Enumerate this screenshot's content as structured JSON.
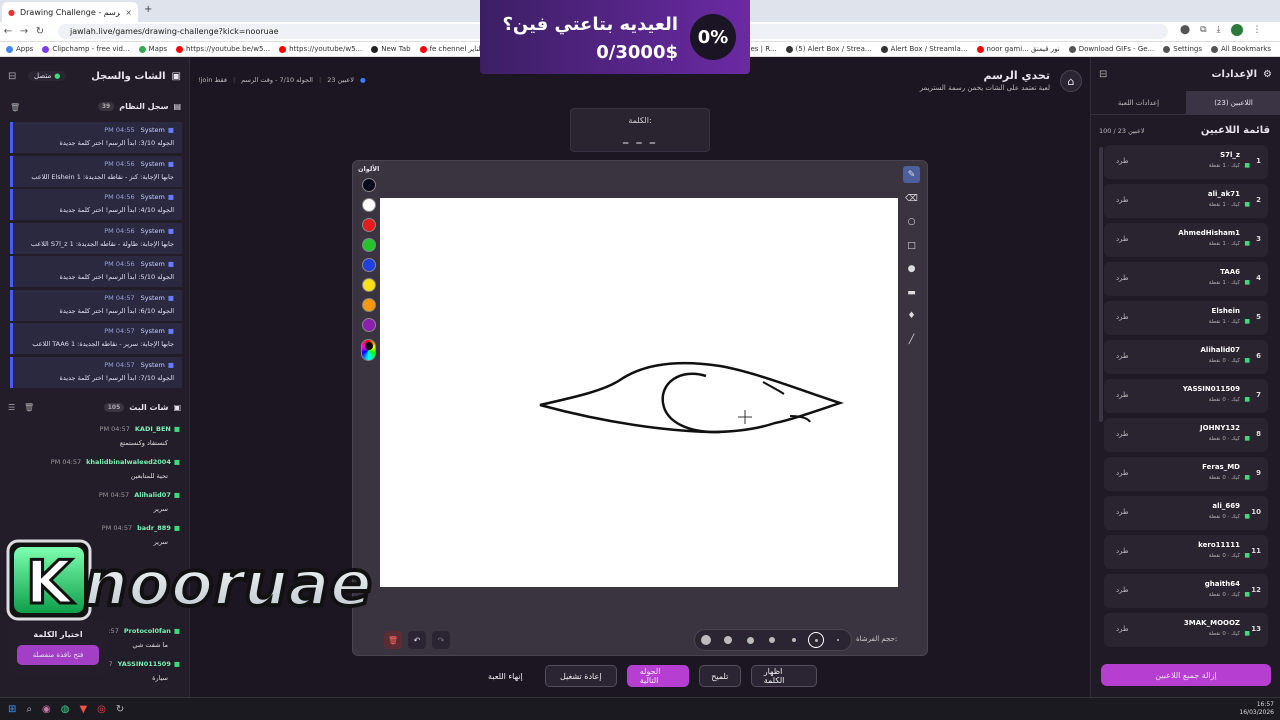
{
  "browser": {
    "tab_title": "Drawing Challenge - تحدي الرسم",
    "tab_close": "×",
    "new_tab": "+",
    "url": "jawlah.live/games/drawing-challenge?kick=nooruae"
  },
  "bookmarks": [
    {
      "label": "Apps",
      "color": "#4285f4"
    },
    {
      "label": "Clipchamp - free vid...",
      "color": "#7a3cf5"
    },
    {
      "label": "Maps",
      "color": "#34a853"
    },
    {
      "label": "https://youtube.be/w5...",
      "color": "#ff0000"
    },
    {
      "label": "https://youtube/w5...",
      "color": "#ff0000"
    },
    {
      "label": "New Tab",
      "color": "#222"
    },
    {
      "label": "fe chennel الناير PU...",
      "color": "#ff0000"
    }
  ],
  "bookmarks_right": [
    {
      "label": "Wheel of Names | R...",
      "color": "#c44"
    },
    {
      "label": "(5) Alert Box / Strea...",
      "color": "#333"
    },
    {
      "label": "Alert Box / Streamla...",
      "color": "#333"
    },
    {
      "label": "noor gami... نور قيمنق",
      "color": "#ff0000"
    },
    {
      "label": "Download GIFs - Ge...",
      "color": "#555"
    },
    {
      "label": "Settings",
      "color": "#555"
    },
    {
      "label": "All Bookmarks",
      "color": "#555"
    }
  ],
  "banner": {
    "title": "العيديه بتاعتي فين؟",
    "value": "0/3000$",
    "percent": "0%"
  },
  "header": {
    "title": "تحدي الرسم",
    "subtitle": "لعبة تعتمد على الشات يخمن رسمة الستريمر",
    "players": "23 لاعبين",
    "round": "الجوله 7/10 - وقت الرسم",
    "join": "!join فقط"
  },
  "left": {
    "title": "الشات والسجل",
    "status": "متصل",
    "system_log": "سجل النظام",
    "log_count": "39",
    "chat_title": "شات البث",
    "chat_count": "105"
  },
  "system_messages": [
    {
      "time": "PM 04:55",
      "sender": "System",
      "text": "الجوله 3/10: ابدأ الرسم! اختر كلمة جديدة"
    },
    {
      "time": "PM 04:56",
      "sender": "System",
      "text": "اللاعب Elshein جابها الإجابة: كنز - نقاطه الجديدة: 1"
    },
    {
      "time": "PM 04:56",
      "sender": "System",
      "text": "الجوله 4/10: ابدأ الرسم! اختر كلمة جديدة"
    },
    {
      "time": "PM 04:56",
      "sender": "System",
      "text": "اللاعب S7l_z جابها الإجابة: طاولة - نقاطه الجديدة: 1"
    },
    {
      "time": "PM 04:56",
      "sender": "System",
      "text": "الجوله 5/10: ابدأ الرسم! اختر كلمة جديدة"
    },
    {
      "time": "PM 04:57",
      "sender": "System",
      "text": "الجوله 6/10: ابدأ الرسم! اختر كلمة جديدة"
    },
    {
      "time": "PM 04:57",
      "sender": "System",
      "text": "اللاعب TAA6 جابها الإجابة: سرير - نقاطه الجديدة: 1"
    },
    {
      "time": "PM 04:57",
      "sender": "System",
      "text": "الجوله 7/10: ابدأ الرسم! اختر كلمة جديدة"
    }
  ],
  "chat_messages": [
    {
      "name": "KADI_BEN",
      "time": "PM 04:57",
      "text": "كنستفاد وكنستمتع"
    },
    {
      "name": "khalidbinalwaleed2004",
      "time": "PM 04:57",
      "text": "تحية للمتابعين"
    },
    {
      "name": "Alihalid07",
      "time": "PM 04:57",
      "text": "سرير"
    },
    {
      "name": "badr_889",
      "time": "PM 04:57",
      "text": "سرير"
    }
  ],
  "chat_lower": [
    {
      "name": "Protocol0fan",
      "time": "PM 04:57",
      "text": "ما شفت شي"
    },
    {
      "name": "YASSIN011509",
      "time": "PM 04:57",
      "text": "سيارة"
    }
  ],
  "word_select": {
    "title": "اختيار الكلمة",
    "button": "فتح نافذة منفصلة"
  },
  "logo_text": "nooruae",
  "logo_k": "K",
  "canvas": {
    "word_label": "الكلمة:",
    "word_mask": "_ _ _",
    "colors_label": "الألوان",
    "brush_label": "حجم الفرشاة:",
    "colors": [
      "#0a0a1a",
      "#ffffff",
      "#e11d1d",
      "#22c52a",
      "#1f3fe0",
      "#f7e11a",
      "#f59a0b",
      "#8b1fb0"
    ]
  },
  "controls": {
    "end": "إنهاء اللعبة",
    "restart": "إعادة تشغيل",
    "next": "الجوله التالية",
    "hint": "تلميح",
    "reveal": "اظهار الكلمة"
  },
  "right": {
    "title": "الإعدادات",
    "tab_players": "اللاعبين (23)",
    "tab_game": "إعدادات اللعبة",
    "list_title": "قائمة اللاعبين",
    "list_count": "100 / 23 لاعبين",
    "kick_label": "طرد",
    "remove_all": "إزالة جميع اللاعبين"
  },
  "players": [
    {
      "n": "1",
      "name": "S7l_z",
      "score": "كيك · 1 نقطة"
    },
    {
      "n": "2",
      "name": "ali_ak71",
      "score": "كيك · 1 نقطة"
    },
    {
      "n": "3",
      "name": "AhmedHisham1",
      "score": "كيك · 1 نقطة"
    },
    {
      "n": "4",
      "name": "TAA6",
      "score": "كيك · 1 نقطة"
    },
    {
      "n": "5",
      "name": "Elshein",
      "score": "كيك · 1 نقطة"
    },
    {
      "n": "6",
      "name": "Alihalid07",
      "score": "كيك · 0 نقطة"
    },
    {
      "n": "7",
      "name": "YASSIN011509",
      "score": "كيك · 0 نقطة"
    },
    {
      "n": "8",
      "name": "JOHNY132",
      "score": "كيك · 0 نقطة"
    },
    {
      "n": "9",
      "name": "Feras_MD",
      "score": "كيك · 0 نقطة"
    },
    {
      "n": "10",
      "name": "ali_669",
      "score": "كيك · 0 نقطة"
    },
    {
      "n": "11",
      "name": "kero11111",
      "score": "كيك · 0 نقطة"
    },
    {
      "n": "12",
      "name": "ghaith64",
      "score": "كيك · 0 نقطة"
    },
    {
      "n": "13",
      "name": "3MAK_MOOOZ",
      "score": "كيك · 0 نقطة"
    }
  ],
  "taskbar": {
    "time": "16:57",
    "date": "16/03/2026"
  }
}
